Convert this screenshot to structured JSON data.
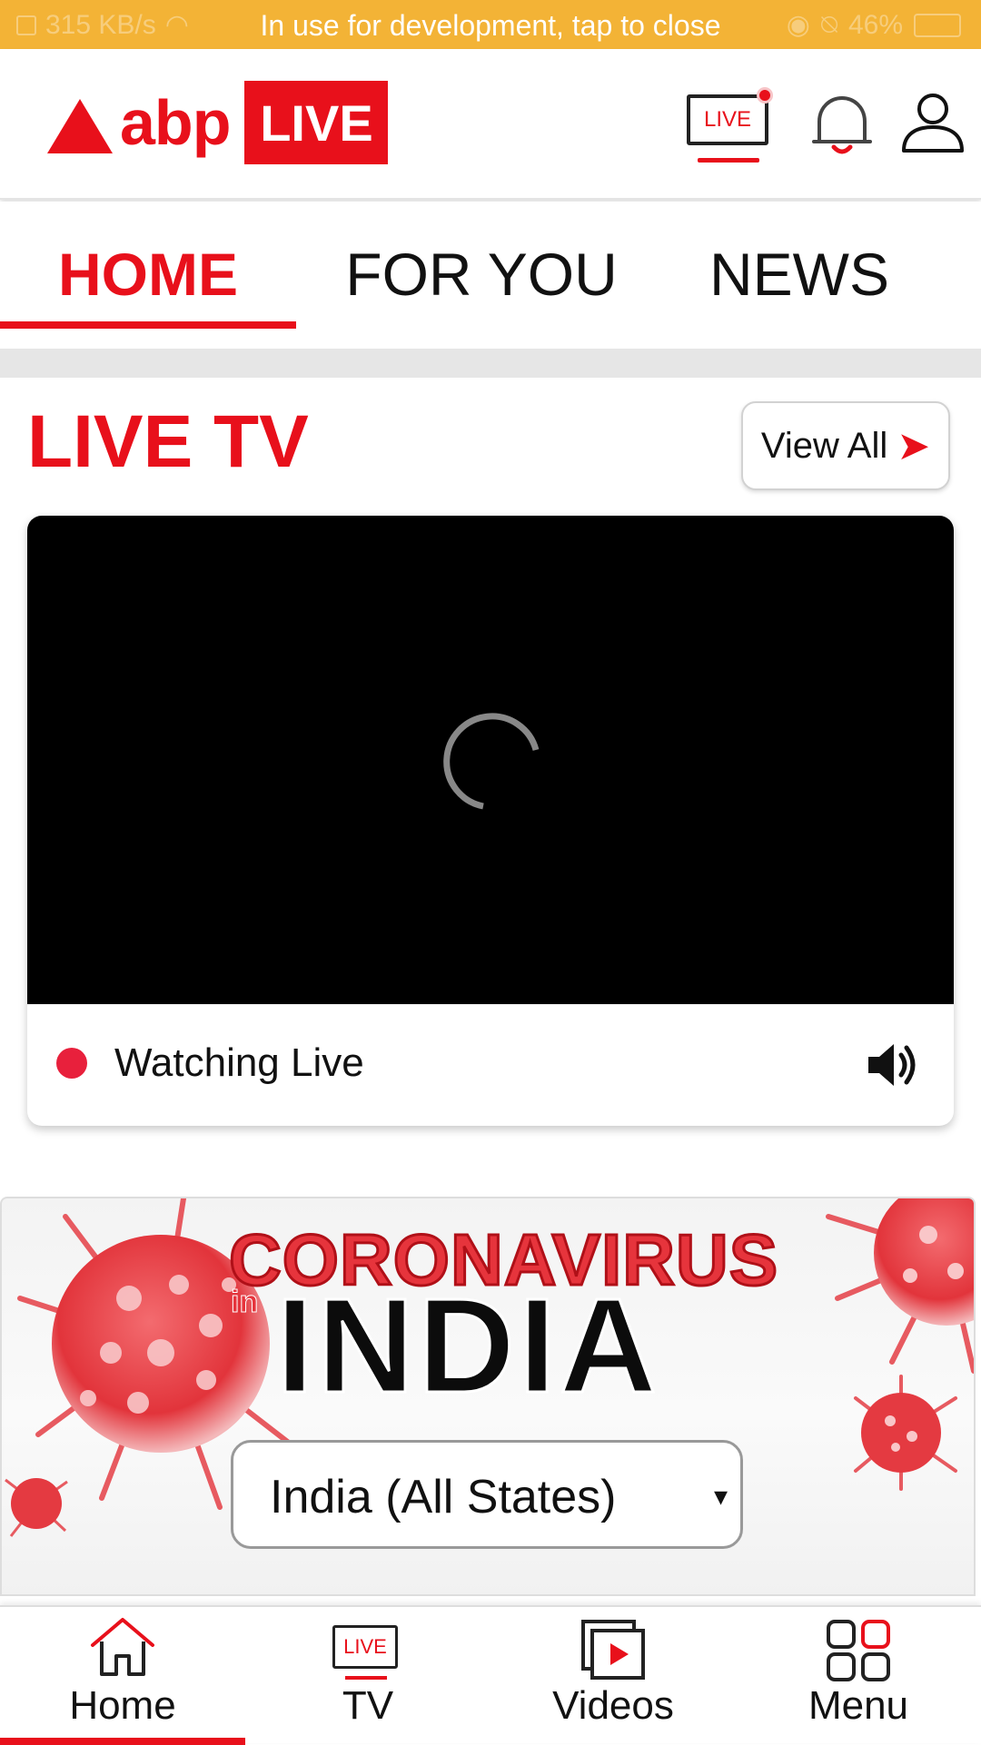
{
  "status_bar": {
    "speed": "315 KB/s",
    "message": "In use for development, tap to close",
    "battery": "46%"
  },
  "header": {
    "logo_text": "abp",
    "logo_badge": "LIVE",
    "live_icon_text": "LIVE"
  },
  "tabs": [
    {
      "label": "HOME",
      "active": true
    },
    {
      "label": "FOR YOU",
      "active": false
    },
    {
      "label": "NEWS",
      "active": false
    }
  ],
  "live_tv": {
    "title": "LIVE TV",
    "view_all": "View All",
    "status": "Watching Live"
  },
  "banner": {
    "title_top": "CORONAVIRUS",
    "title_in": "in",
    "title_main": "INDIA",
    "select_value": "India (All States)",
    "select_caret": "▾"
  },
  "bottom_nav": [
    {
      "label": "Home",
      "active": true
    },
    {
      "label": "TV",
      "icon_text": "LIVE",
      "active": false
    },
    {
      "label": "Videos",
      "active": false
    },
    {
      "label": "Menu",
      "active": false
    }
  ],
  "colors": {
    "brand_red": "#e8101b",
    "status_bar": "#f3b336",
    "live_dot": "#e8203c"
  }
}
